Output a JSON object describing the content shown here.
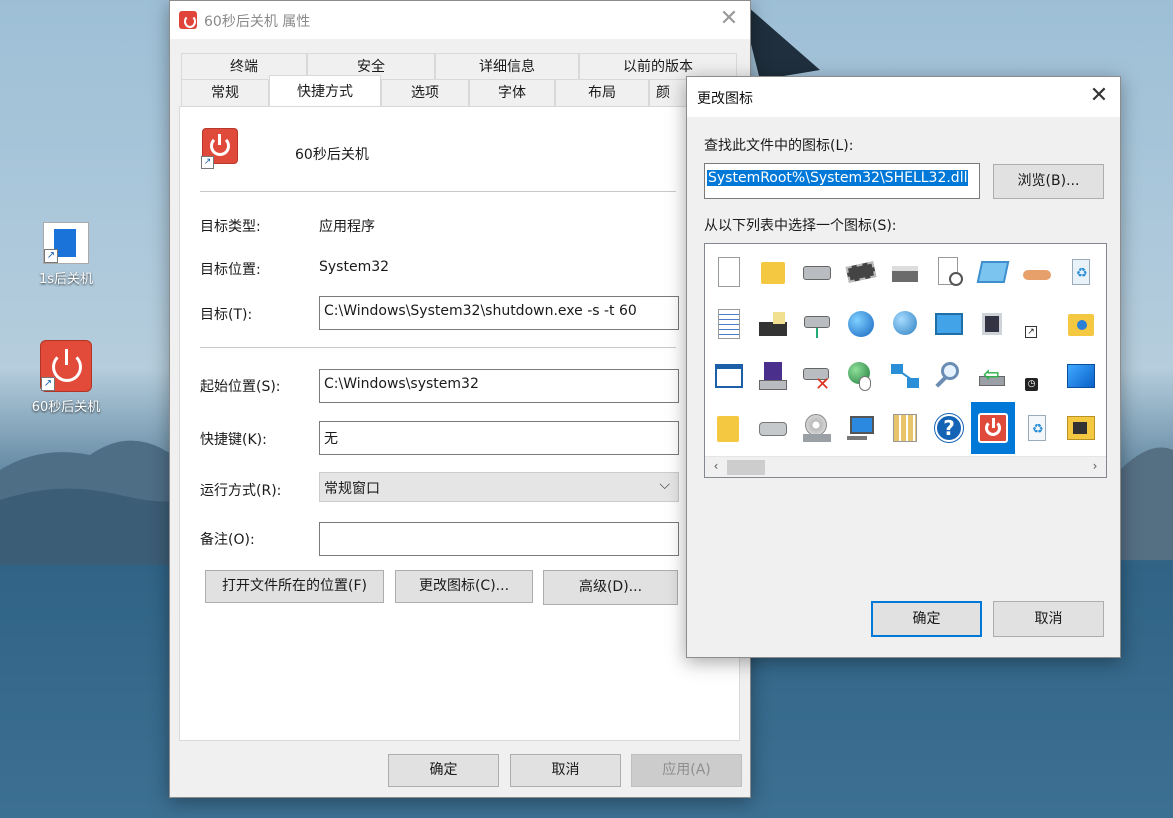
{
  "desktop": {
    "icons": [
      {
        "label": "1s后关机"
      },
      {
        "label": "60秒后关机"
      }
    ]
  },
  "properties": {
    "title": "60秒后关机 属性",
    "tabs_row1": [
      "终端",
      "安全",
      "详细信息",
      "以前的版本"
    ],
    "tabs_row2": [
      "常规",
      "快捷方式",
      "选项",
      "字体",
      "布局",
      "颜"
    ],
    "shortcut_name": "60秒后关机",
    "target_type_label": "目标类型:",
    "target_type_value": "应用程序",
    "target_location_label": "目标位置:",
    "target_location_value": "System32",
    "target_label": "目标(T):",
    "target_value": "C:\\Windows\\System32\\shutdown.exe -s -t 60",
    "start_in_label": "起始位置(S):",
    "start_in_value": "C:\\Windows\\system32",
    "hotkey_label": "快捷键(K):",
    "hotkey_value": "无",
    "run_label": "运行方式(R):",
    "run_value": "常规窗口",
    "comment_label": "备注(O):",
    "comment_value": "",
    "open_location_button": "打开文件所在的位置(F)",
    "change_icon_button": "更改图标(C)...",
    "advanced_button": "高级(D)...",
    "ok_button": "确定",
    "cancel_button": "取消",
    "apply_button": "应用(A)"
  },
  "change_icon": {
    "title": "更改图标",
    "find_label": "查找此文件中的图标(L):",
    "path_value": "SystemRoot%\\System32\\SHELL32.dll",
    "browse_button": "浏览(B)...",
    "choose_label": "从以下列表中选择一个图标(S):",
    "ok_button": "确定",
    "cancel_button": "取消",
    "icons": [
      "blank-document-icon",
      "folder-icon",
      "drive-icon",
      "memory-chip-icon",
      "printer-icon",
      "clock-document-icon",
      "window-icon",
      "shared-hand-icon",
      "recycle-bin-full-icon",
      "text-document-icon",
      "floppy-computer-icon",
      "network-drive-icon",
      "internet-globe-icon",
      "network-globe-icon",
      "control-panel-icon",
      "computer-shortcut-icon",
      "shortcut-arrow-icon",
      "folder-settings-icon",
      "window-frame-icon",
      "floppy-drive-icon",
      "disconnected-drive-icon",
      "globe-mouse-icon",
      "network-icon",
      "magnifier-icon",
      "green-arrow-icon",
      "clock-badge-icon",
      "blue-desktop-icon",
      "folder-icon-2",
      "hard-drive-icon",
      "cd-drive-icon",
      "monitor-icon",
      "tile-grid-icon",
      "help-icon",
      "power-icon",
      "recycle-bin-empty-icon",
      "tools-folder-icon"
    ],
    "selected_icon": "power-icon"
  }
}
